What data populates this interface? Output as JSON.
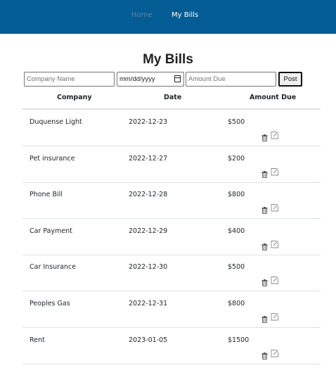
{
  "nav": {
    "home": "Home",
    "bills": "My Bills"
  },
  "page": {
    "title": "My Bills"
  },
  "form": {
    "company_placeholder": "Company Name",
    "date_placeholder": "mm/dd/yyyy",
    "amount_placeholder": "Amount Due",
    "post_label": "Post"
  },
  "table": {
    "headers": [
      "Company",
      "Date",
      "Amount Due"
    ],
    "rows": [
      {
        "company": "Duquense Light",
        "date": "2022-12-23",
        "amount": "$500"
      },
      {
        "company": "Pet insurance",
        "date": "2022-12-27",
        "amount": "$200"
      },
      {
        "company": "Phone Bill",
        "date": "2022-12-28",
        "amount": "$800"
      },
      {
        "company": "Car Payment",
        "date": "2022-12-29",
        "amount": "$400"
      },
      {
        "company": "Car Insurance",
        "date": "2022-12-30",
        "amount": "$500"
      },
      {
        "company": "Peoples Gas",
        "date": "2022-12-31",
        "amount": "$800"
      },
      {
        "company": "Rent",
        "date": "2023-01-05",
        "amount": "$1500"
      }
    ],
    "row_actions": [
      "trash-icon",
      "edit-icon"
    ]
  },
  "colors": {
    "navbar": "#045c94",
    "nav_inactive": "#5d87a6",
    "nav_active": "#ffffff",
    "rule": "#dee2e6"
  }
}
